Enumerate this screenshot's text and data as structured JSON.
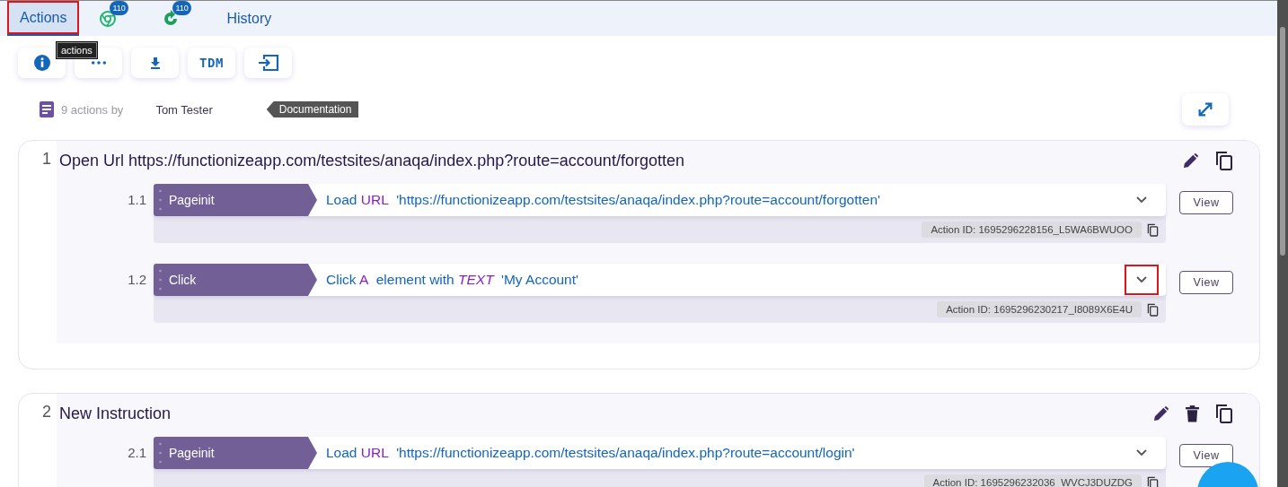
{
  "tabs": [
    {
      "kind": "text",
      "label": "Actions",
      "selected": true,
      "highlighted": true
    },
    {
      "kind": "chrome",
      "badge": "110",
      "selected": false,
      "highlighted": false
    },
    {
      "kind": "refresh",
      "badge": "110",
      "selected": false,
      "highlighted": false
    },
    {
      "kind": "text",
      "label": "History",
      "selected": false,
      "highlighted": false
    }
  ],
  "tooltip": "actions",
  "toolbar": [
    {
      "kind": "info"
    },
    {
      "kind": "more"
    },
    {
      "kind": "download"
    },
    {
      "kind": "text",
      "label": "TDM"
    },
    {
      "kind": "import"
    }
  ],
  "summary": {
    "count": "9 actions by",
    "author": "Tom Tester",
    "tag": "Documentation"
  },
  "groups": [
    {
      "number": "1",
      "title": "Open Url https://functionizeapp.com/testsites/anaqa/index.php?route=account/forgotten",
      "deletable": false,
      "steps": [
        {
          "number": "1.1",
          "type": "Pageinit",
          "description": [
            {
              "kind": "plain",
              "text": "Load"
            },
            {
              "kind": "keyword",
              "text": "URL"
            },
            {
              "kind": "plain",
              "text": "'https://functionizeapp.com/testsites/anaqa/index.php?route=account/forgotten'"
            }
          ],
          "action_id": "Action ID: 1695296228156_L5WA6BWUOO",
          "highlighted": false,
          "view": "View"
        },
        {
          "number": "1.2",
          "type": "Click",
          "description": [
            {
              "kind": "plain",
              "text": "Click"
            },
            {
              "kind": "keyword",
              "text": "A"
            },
            {
              "kind": "plain",
              "text": "element with"
            },
            {
              "kind": "keyword-italic",
              "text": "TEXT"
            },
            {
              "kind": "plain",
              "text": "'My Account'"
            }
          ],
          "action_id": "Action ID: 1695296230217_I8089X6E4U",
          "highlighted": true,
          "view": "View"
        }
      ]
    },
    {
      "number": "2",
      "title": "New Instruction",
      "deletable": true,
      "steps": [
        {
          "number": "2.1",
          "type": "Pageinit",
          "description": [
            {
              "kind": "plain",
              "text": "Load"
            },
            {
              "kind": "keyword",
              "text": "URL"
            },
            {
              "kind": "plain",
              "text": "'https://functionizeapp.com/testsites/anaqa/index.php?route=account/login'"
            }
          ],
          "action_id": "Action ID: 1695296232036_WVCJ3DUZDG",
          "highlighted": false,
          "view": "View"
        }
      ]
    }
  ]
}
